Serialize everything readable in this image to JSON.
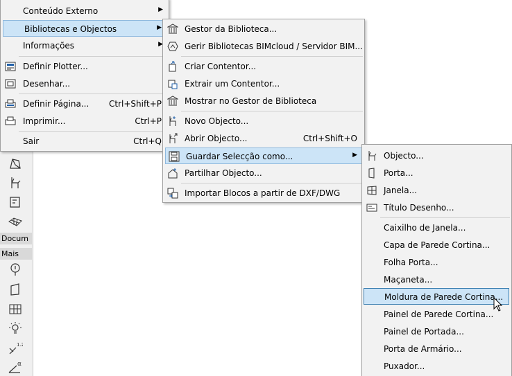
{
  "menu_main": {
    "items": [
      {
        "label": "Conteúdo Externo",
        "shortcut": "",
        "submenu": true,
        "icon": ""
      },
      {
        "label": "Bibliotecas e Objectos",
        "shortcut": "",
        "submenu": true,
        "icon": ""
      },
      {
        "label": "Informações",
        "shortcut": "",
        "submenu": true,
        "icon": ""
      },
      {
        "label": "Definir Plotter...",
        "shortcut": "",
        "submenu": false,
        "icon": "plotter-icon"
      },
      {
        "label": "Desenhar...",
        "shortcut": "",
        "submenu": false,
        "icon": "plot-icon"
      },
      {
        "label": "Definir Página...",
        "shortcut": "Ctrl+Shift+P",
        "submenu": false,
        "icon": "page-setup-icon"
      },
      {
        "label": "Imprimir...",
        "shortcut": "Ctrl+P",
        "submenu": false,
        "icon": "printer-icon"
      },
      {
        "label": "Sair",
        "shortcut": "Ctrl+Q",
        "submenu": false,
        "icon": ""
      }
    ]
  },
  "menu_libraries": {
    "items": [
      {
        "label": "Gestor da Biblioteca...",
        "shortcut": "",
        "icon": "library-manager-icon"
      },
      {
        "label": "Gerir Bibliotecas BIMcloud / Servidor BIM...",
        "shortcut": "",
        "icon": "bimcloud-icon"
      },
      {
        "label": "Criar Contentor...",
        "shortcut": "",
        "icon": "create-container-icon"
      },
      {
        "label": "Extrair um Contentor...",
        "shortcut": "",
        "icon": "extract-container-icon"
      },
      {
        "label": "Mostrar no Gestor de Biblioteca",
        "shortcut": "",
        "icon": "show-library-icon"
      },
      {
        "label": "Novo Objecto...",
        "shortcut": "",
        "icon": "new-object-icon"
      },
      {
        "label": "Abrir Objecto...",
        "shortcut": "Ctrl+Shift+O",
        "icon": "open-object-icon"
      },
      {
        "label": "Guardar Selecção como...",
        "shortcut": "",
        "icon": "save-icon"
      },
      {
        "label": "Partilhar Objecto...",
        "shortcut": "",
        "icon": "share-object-icon"
      },
      {
        "label": "Importar Blocos a partir de DXF/DWG",
        "shortcut": "",
        "icon": "import-blocks-icon"
      }
    ]
  },
  "menu_save_as": {
    "items": [
      {
        "label": "Objecto...",
        "icon": "object-icon"
      },
      {
        "label": "Porta...",
        "icon": "door-icon"
      },
      {
        "label": "Janela...",
        "icon": "window-icon"
      },
      {
        "label": "Título Desenho...",
        "icon": "drawing-title-icon"
      },
      {
        "label": "Caixilho de Janela...",
        "icon": ""
      },
      {
        "label": "Capa de Parede Cortina...",
        "icon": ""
      },
      {
        "label": "Folha Porta...",
        "icon": ""
      },
      {
        "label": "Maçaneta...",
        "icon": ""
      },
      {
        "label": "Moldura de Parede Cortina...",
        "icon": ""
      },
      {
        "label": "Painel de Parede Cortina...",
        "icon": ""
      },
      {
        "label": "Painel de Portada...",
        "icon": ""
      },
      {
        "label": "Porta de Armário...",
        "icon": ""
      },
      {
        "label": "Puxador...",
        "icon": ""
      }
    ]
  },
  "toolbox": {
    "section_document": "Docum",
    "section_more": "Mais"
  },
  "colors": {
    "highlight": "#cce4f7",
    "highlight_border": "#3c7fb1",
    "menu_bg": "#f2f2f2",
    "accent_icon": "#1f5fa8"
  }
}
